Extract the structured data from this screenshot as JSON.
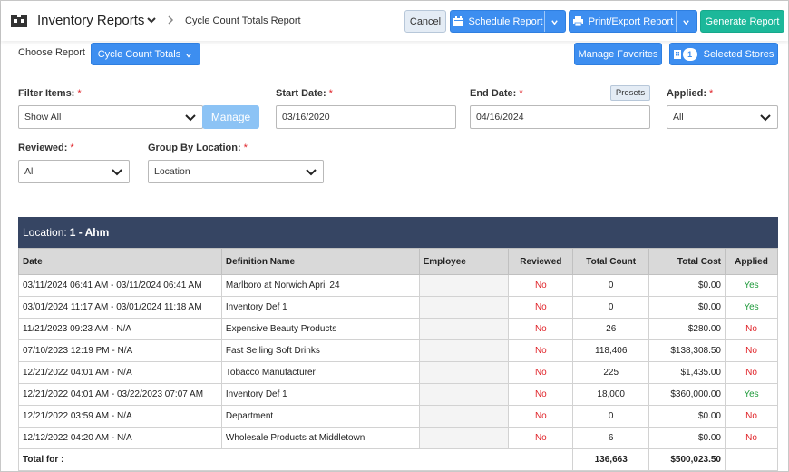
{
  "header": {
    "app_title": "Inventory Reports",
    "breadcrumb": "Cycle Count Totals Report",
    "cancel": "Cancel",
    "schedule": "Schedule Report",
    "print_export": "Print/Export Report",
    "generate": "Generate Report"
  },
  "choose": {
    "label": "Choose Report",
    "selected": "Cycle Count Totals",
    "manage_favorites": "Manage Favorites",
    "stores_count": "1",
    "selected_stores": "Selected Stores"
  },
  "filters": {
    "filter_items_label": "Filter Items:",
    "filter_items_value": "Show All",
    "manage": "Manage",
    "start_date_label": "Start Date:",
    "start_date_value": "03/16/2020",
    "end_date_label": "End Date:",
    "end_date_value": "04/16/2024",
    "presets": "Presets",
    "applied_label": "Applied:",
    "applied_value": "All",
    "reviewed_label": "Reviewed:",
    "reviewed_value": "All",
    "group_label": "Group By Location:",
    "group_value": "Location",
    "required_mark": "*"
  },
  "location": {
    "prefix": "Location:",
    "name": "1 - Ahm"
  },
  "table": {
    "columns": [
      "Date",
      "Definition Name",
      "Employee",
      "Reviewed",
      "Total Count",
      "Total Cost",
      "Applied"
    ],
    "rows": [
      {
        "date": "03/11/2024 06:41 AM - 03/11/2024 06:41 AM",
        "definition": "Marlboro at Norwich April 24",
        "reviewed": "No",
        "count": "0",
        "cost": "$0.00",
        "applied": "Yes"
      },
      {
        "date": "03/01/2024 11:17 AM - 03/01/2024 11:18 AM",
        "definition": "Inventory Def 1",
        "reviewed": "No",
        "count": "0",
        "cost": "$0.00",
        "applied": "Yes"
      },
      {
        "date": "11/21/2023 09:23 AM - N/A",
        "definition": "Expensive Beauty Products",
        "reviewed": "No",
        "count": "26",
        "cost": "$280.00",
        "applied": "No"
      },
      {
        "date": "07/10/2023 12:19 PM - N/A",
        "definition": "Fast Selling Soft Drinks",
        "reviewed": "No",
        "count": "118,406",
        "cost": "$138,308.50",
        "applied": "No"
      },
      {
        "date": "12/21/2022 04:01 AM - N/A",
        "definition": "Tobacco Manufacturer",
        "reviewed": "No",
        "count": "225",
        "cost": "$1,435.00",
        "applied": "No"
      },
      {
        "date": "12/21/2022 04:01 AM - 03/22/2023 07:07 AM",
        "definition": "Inventory Def 1",
        "reviewed": "No",
        "count": "18,000",
        "cost": "$360,000.00",
        "applied": "Yes"
      },
      {
        "date": "12/21/2022 03:59 AM - N/A",
        "definition": "Department",
        "reviewed": "No",
        "count": "0",
        "cost": "$0.00",
        "applied": "No"
      },
      {
        "date": "12/12/2022 04:20 AM - N/A",
        "definition": "Wholesale Products at Middletown",
        "reviewed": "No",
        "count": "6",
        "cost": "$0.00",
        "applied": "No"
      }
    ],
    "total_label": "Total for :",
    "total_count": "136,663",
    "total_cost": "$500,023.50"
  },
  "colors": {
    "primary": "#3d8ef0",
    "generate": "#1cb89a",
    "location_header": "#364563",
    "no": "#e0242a",
    "yes": "#1e9a3a"
  }
}
